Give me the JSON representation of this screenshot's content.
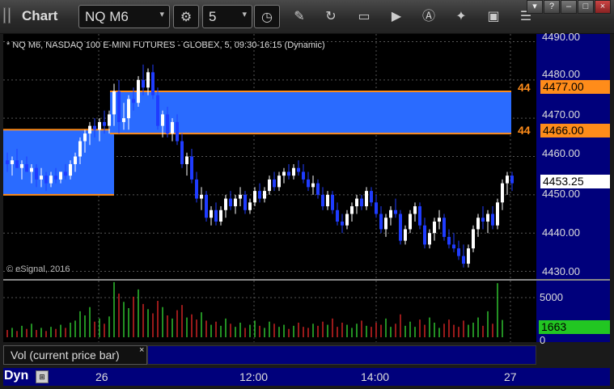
{
  "window": {
    "title": "Chart",
    "symbol": "NQ M6",
    "interval": "5",
    "icons": [
      "cursor-icon",
      "draw-icon",
      "refresh-icon",
      "quote-icon",
      "play-icon",
      "alert-icon",
      "tools-icon",
      "window-icon",
      "menu-icon"
    ]
  },
  "chart": {
    "series_label": "* NQ M6, NASDAQ 100 E-MINI FUTURES - GLOBEX, 5, 09:30-16:15 (Dynamic)",
    "copyright": "© eSignal, 2016",
    "upper_level": "4477.00",
    "lower_level": "4466.00",
    "last_price": "4453.25",
    "trunc_upper": "44",
    "trunc_lower": "44",
    "volume_last": "1663",
    "volume_legend": "Vol (current price bar)",
    "close_x": "×",
    "dyn_label": "Dyn",
    "price_ticks": [
      "4490.00",
      "4480.00",
      "4470.00",
      "4460.00",
      "4450.00",
      "4440.00",
      "4430.00"
    ],
    "volume_ticks": [
      "5000",
      "0"
    ],
    "time_ticks": [
      "26",
      "12:00",
      "14:00",
      "27"
    ],
    "colors": {
      "up": "#ffffff",
      "down": "#1f3cff",
      "zone": "#2a6bff",
      "level": "#ff8c1a",
      "vol_up": "#2fc02f",
      "vol_down": "#cc2222"
    }
  },
  "chart_data": {
    "type": "candlestick",
    "ylim": [
      4428,
      4492
    ],
    "zones": [
      {
        "from_bar": 0,
        "to_bar": 22,
        "low": 4450.0,
        "high": 4467.0
      },
      {
        "from_bar": 22,
        "to_bar": 125,
        "low": 4466.0,
        "high": 4477.0
      }
    ],
    "candles": [
      [
        4459,
        4461,
        4456,
        4458
      ],
      [
        4458,
        4460,
        4455,
        4459
      ],
      [
        4459,
        4462,
        4457,
        4457
      ],
      [
        4457,
        4459,
        4454,
        4458
      ],
      [
        4458,
        4460,
        4456,
        4456
      ],
      [
        4456,
        4458,
        4453,
        4457
      ],
      [
        4457,
        4458,
        4452,
        4454
      ],
      [
        4454,
        4457,
        4452,
        4455
      ],
      [
        4455,
        4456,
        4451,
        4453
      ],
      [
        4453,
        4456,
        4452,
        4455
      ],
      [
        4455,
        4457,
        4453,
        4454
      ],
      [
        4454,
        4456,
        4453,
        4456
      ],
      [
        4456,
        4458,
        4454,
        4455
      ],
      [
        4455,
        4459,
        4454,
        4458
      ],
      [
        4458,
        4461,
        4456,
        4460
      ],
      [
        4460,
        4465,
        4458,
        4464
      ],
      [
        4464,
        4467,
        4461,
        4466
      ],
      [
        4466,
        4469,
        4463,
        4468
      ],
      [
        4468,
        4470,
        4465,
        4467
      ],
      [
        4467,
        4470,
        4464,
        4469
      ],
      [
        4469,
        4472,
        4466,
        4468
      ],
      [
        4468,
        4472,
        4466,
        4471
      ],
      [
        4471,
        4479,
        4468,
        4477
      ],
      [
        4477,
        4480,
        4466,
        4469
      ],
      [
        4469,
        4474,
        4467,
        4470
      ],
      [
        4470,
        4476,
        4467,
        4475
      ],
      [
        4475,
        4478,
        4472,
        4474
      ],
      [
        4474,
        4481,
        4473,
        4480
      ],
      [
        4480,
        4484,
        4476,
        4478
      ],
      [
        4478,
        4483,
        4476,
        4482
      ],
      [
        4482,
        4484,
        4475,
        4476
      ],
      [
        4476,
        4478,
        4467,
        4468
      ],
      [
        4468,
        4472,
        4465,
        4471
      ],
      [
        4471,
        4473,
        4465,
        4466
      ],
      [
        4466,
        4470,
        4464,
        4469
      ],
      [
        4469,
        4471,
        4463,
        4464
      ],
      [
        4464,
        4466,
        4457,
        4458
      ],
      [
        4458,
        4461,
        4455,
        4460
      ],
      [
        4460,
        4462,
        4453,
        4454
      ],
      [
        4454,
        4456,
        4448,
        4449
      ],
      [
        4449,
        4452,
        4446,
        4450
      ],
      [
        4450,
        4451,
        4443,
        4444
      ],
      [
        4444,
        4447,
        4442,
        4446
      ],
      [
        4446,
        4448,
        4442,
        4443
      ],
      [
        4443,
        4447,
        4442,
        4446
      ],
      [
        4446,
        4450,
        4444,
        4449
      ],
      [
        4449,
        4451,
        4446,
        4447
      ],
      [
        4447,
        4450,
        4445,
        4449
      ],
      [
        4449,
        4452,
        4447,
        4450
      ],
      [
        4450,
        4451,
        4445,
        4446
      ],
      [
        4446,
        4449,
        4445,
        4448
      ],
      [
        4448,
        4452,
        4447,
        4451
      ],
      [
        4451,
        4453,
        4448,
        4449
      ],
      [
        4449,
        4452,
        4448,
        4451
      ],
      [
        4451,
        4455,
        4450,
        4454
      ],
      [
        4454,
        4456,
        4451,
        4452
      ],
      [
        4452,
        4456,
        4451,
        4455
      ],
      [
        4455,
        4457,
        4453,
        4456
      ],
      [
        4456,
        4458,
        4454,
        4455
      ],
      [
        4455,
        4458,
        4454,
        4457
      ],
      [
        4457,
        4459,
        4455,
        4456
      ],
      [
        4456,
        4458,
        4453,
        4454
      ],
      [
        4454,
        4456,
        4451,
        4452
      ],
      [
        4452,
        4455,
        4450,
        4453
      ],
      [
        4453,
        4454,
        4449,
        4450
      ],
      [
        4450,
        4452,
        4446,
        4447
      ],
      [
        4447,
        4451,
        4446,
        4450
      ],
      [
        4450,
        4451,
        4445,
        4446
      ],
      [
        4446,
        4448,
        4442,
        4443
      ],
      [
        4443,
        4445,
        4440,
        4442
      ],
      [
        4442,
        4446,
        4441,
        4445
      ],
      [
        4445,
        4448,
        4443,
        4447
      ],
      [
        4447,
        4450,
        4445,
        4449
      ],
      [
        4449,
        4450,
        4446,
        4447
      ],
      [
        4447,
        4452,
        4446,
        4451
      ],
      [
        4451,
        4452,
        4447,
        4448
      ],
      [
        4448,
        4450,
        4444,
        4445
      ],
      [
        4445,
        4447,
        4440,
        4441
      ],
      [
        4441,
        4445,
        4439,
        4444
      ],
      [
        4444,
        4447,
        4442,
        4446
      ],
      [
        4446,
        4449,
        4444,
        4445
      ],
      [
        4445,
        4446,
        4437,
        4438
      ],
      [
        4438,
        4442,
        4437,
        4441
      ],
      [
        4441,
        4446,
        4440,
        4445
      ],
      [
        4445,
        4448,
        4443,
        4447
      ],
      [
        4447,
        4448,
        4441,
        4442
      ],
      [
        4442,
        4444,
        4436,
        4437
      ],
      [
        4437,
        4441,
        4436,
        4440
      ],
      [
        4440,
        4444,
        4438,
        4443
      ],
      [
        4443,
        4446,
        4441,
        4444
      ],
      [
        4444,
        4445,
        4438,
        4439
      ],
      [
        4439,
        4441,
        4436,
        4437
      ],
      [
        4437,
        4440,
        4435,
        4436
      ],
      [
        4436,
        4438,
        4433,
        4434
      ],
      [
        4434,
        4437,
        4431,
        4432
      ],
      [
        4432,
        4437,
        4431,
        4436
      ],
      [
        4436,
        4442,
        4435,
        4441
      ],
      [
        4441,
        4445,
        4439,
        4444
      ],
      [
        4444,
        4447,
        4441,
        4443
      ],
      [
        4443,
        4446,
        4440,
        4445
      ],
      [
        4445,
        4447,
        4441,
        4442
      ],
      [
        4442,
        4449,
        4441,
        4448
      ],
      [
        4448,
        4454,
        4446,
        4453
      ],
      [
        4453,
        4456,
        4450,
        4455
      ],
      [
        4455,
        4456,
        4451,
        4453
      ]
    ],
    "volumes": [
      700,
      900,
      600,
      1100,
      800,
      1300,
      700,
      900,
      600,
      1000,
      800,
      1200,
      900,
      1400,
      1600,
      2500,
      2100,
      2900,
      1500,
      1800,
      1300,
      2000,
      5300,
      4200,
      3400,
      2800,
      3900,
      4600,
      3200,
      2700,
      2300,
      3500,
      2900,
      2100,
      1800,
      2600,
      3100,
      1900,
      2200,
      1700,
      2400,
      1600,
      1200,
      1500,
      1100,
      1800,
      1300,
      1000,
      1400,
      900,
      1200,
      1600,
      1100,
      900,
      1500,
      1300,
      1000,
      1200,
      800,
      1100,
      1400,
      1000,
      900,
      1300,
      1100,
      1500,
      1200,
      1800,
      1000,
      1400,
      1200,
      900,
      1300,
      1600,
      1100,
      1000,
      1400,
      1200,
      1800,
      1000,
      1300,
      2200,
      1100,
      1500,
      1000,
      1700,
      1200,
      1900,
      1400,
      900,
      1300,
      1700,
      1200,
      1000,
      1600,
      1200,
      1400,
      1900,
      1100,
      2500,
      1300,
      5200,
      1663
    ]
  }
}
